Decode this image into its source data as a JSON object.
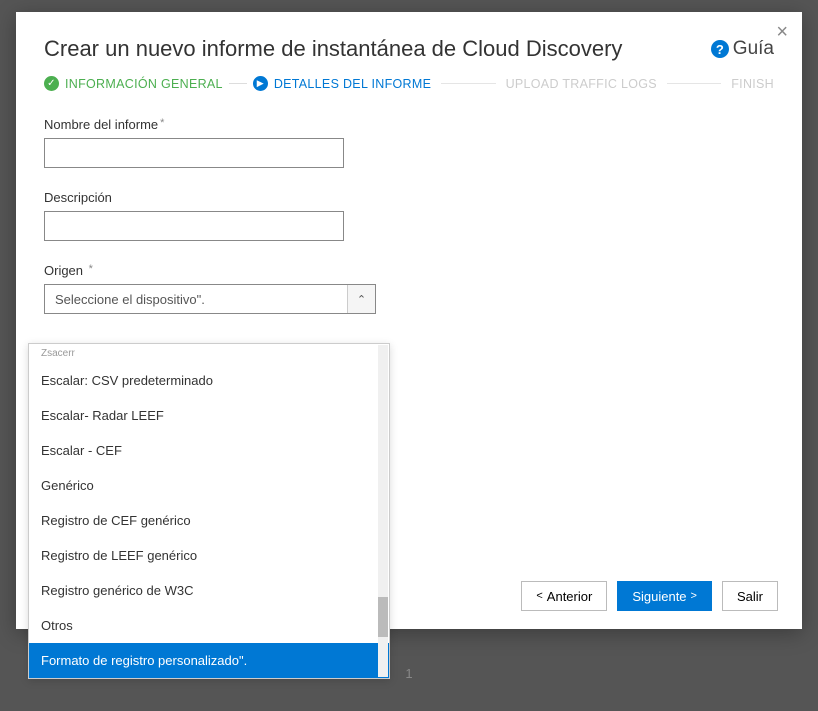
{
  "header": {
    "title": "Crear un nuevo informe de instantánea de Cloud Discovery",
    "guide_label": "Guía",
    "guide_icon": "?"
  },
  "steps": {
    "s1": "INFORMACIÓN GENERAL",
    "s2": "DETALLES DEL INFORME",
    "s3": "UPLOAD TRAFFIC LOGS",
    "s4": "FINISH"
  },
  "form": {
    "report_name_label": "Nombre del informe",
    "report_name_value": "",
    "description_label": "Descripción",
    "description_value": "",
    "source_label": "Origen",
    "source_selected": "Seleccione el dispositivo\"."
  },
  "dropdown": {
    "items": [
      "Zsacerr",
      "Escalar: CSV predeterminado",
      "Escalar- Radar LEEF",
      "Escalar - CEF",
      "Genérico",
      "Registro de CEF genérico",
      "Registro de LEEF genérico",
      "Registro genérico de W3C",
      "Otros",
      "Formato de registro personalizado\"."
    ],
    "selected_index": 9
  },
  "footer": {
    "prev": "Anterior",
    "next": "Siguiente",
    "exit": "Salir"
  },
  "page_number": "1"
}
